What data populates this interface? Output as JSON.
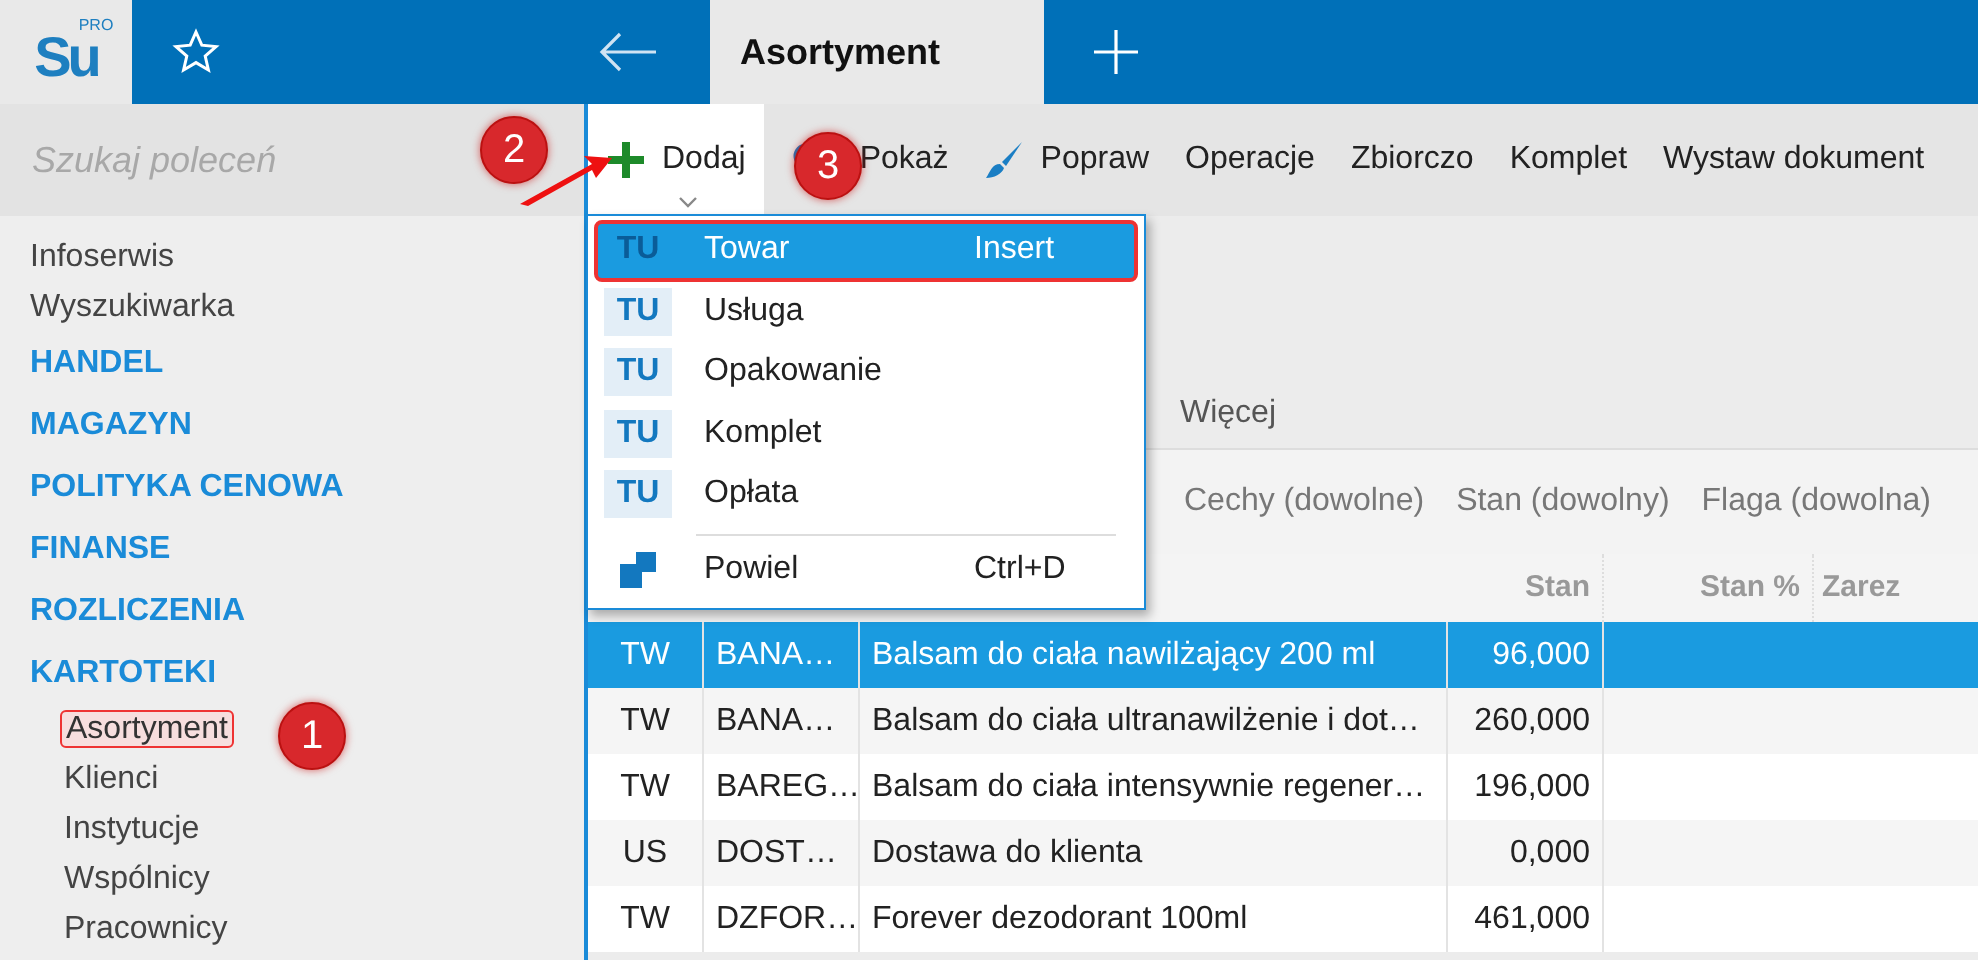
{
  "logo": {
    "text": "Su",
    "sup": "PRO"
  },
  "tabs": [
    {
      "label": "Asortyment",
      "selected": true
    }
  ],
  "search": {
    "placeholder": "Szukaj poleceń"
  },
  "sidebar": {
    "items": [
      {
        "label": "Infoserwis",
        "kind": "link"
      },
      {
        "label": "Wyszukiwarka",
        "kind": "link"
      },
      {
        "label": "HANDEL",
        "kind": "section"
      },
      {
        "label": "MAGAZYN",
        "kind": "section"
      },
      {
        "label": "POLITYKA CENOWA",
        "kind": "section"
      },
      {
        "label": "FINANSE",
        "kind": "section"
      },
      {
        "label": "ROZLICZENIA",
        "kind": "section"
      },
      {
        "label": "KARTOTEKI",
        "kind": "section",
        "children": [
          {
            "label": "Asortyment",
            "selected": true,
            "annotated": true
          },
          {
            "label": "Klienci",
            "selected": false,
            "annotated": false
          },
          {
            "label": "Instytucje",
            "selected": false,
            "annotated": false
          },
          {
            "label": "Wspólnicy",
            "selected": false,
            "annotated": false
          },
          {
            "label": "Pracownicy",
            "selected": false,
            "annotated": false
          }
        ]
      }
    ]
  },
  "toolbar": [
    {
      "label": "Dodaj",
      "kind": "add",
      "selected": true
    },
    {
      "label": "Pokaż",
      "kind": "show",
      "selected": false
    },
    {
      "label": "Popraw",
      "kind": "edit",
      "selected": false
    },
    {
      "label": "Operacje",
      "kind": "plain",
      "selected": false
    },
    {
      "label": "Zbiorczo",
      "kind": "plain",
      "selected": false
    },
    {
      "label": "Komplet",
      "kind": "plain",
      "selected": false
    },
    {
      "label": "Wystaw dokument",
      "kind": "plain",
      "selected": false
    }
  ],
  "menu": [
    {
      "kind": "type",
      "badge": "TU",
      "label": "Towar",
      "shortcut": "Insert",
      "selected": true,
      "annotated": true
    },
    {
      "kind": "type",
      "badge": "TU",
      "label": "Usługa",
      "selected": false,
      "annotated": false
    },
    {
      "kind": "type",
      "badge": "TU",
      "label": "Opakowanie",
      "selected": false,
      "annotated": false
    },
    {
      "kind": "type",
      "badge": "TU",
      "label": "Komplet",
      "selected": false,
      "annotated": false
    },
    {
      "kind": "type",
      "badge": "TU",
      "label": "Opłata",
      "selected": false,
      "annotated": false
    },
    {
      "kind": "copy",
      "label": "Powiel",
      "shortcut": "Ctrl+D",
      "selected": false,
      "annotated": false
    }
  ],
  "view_tabs": [
    {
      "label": "Więcej"
    }
  ],
  "filters": [
    "Cechy (dowolne)",
    "Stan (dowolny)",
    "Flaga (dowolna)"
  ],
  "table": {
    "columns": [
      "Stan",
      "Stan %",
      "Zarez"
    ],
    "rows": [
      {
        "type": "TW",
        "code": "BANA…",
        "name": "Balsam do ciała nawilżający 200 ml",
        "stan": "96,000",
        "selected": true
      },
      {
        "type": "TW",
        "code": "BANA…",
        "name": "Balsam do ciała ultranawilżenie i dot…",
        "stan": "260,000",
        "selected": false
      },
      {
        "type": "TW",
        "code": "BAREG…",
        "name": "Balsam do ciała intensywnie regener…",
        "stan": "196,000",
        "selected": false
      },
      {
        "type": "US",
        "code": "DOST…",
        "name": "Dostawa do klienta",
        "stan": "0,000",
        "selected": false
      },
      {
        "type": "TW",
        "code": "DZFOR…",
        "name": "Forever dezodorant 100ml",
        "stan": "461,000",
        "selected": false
      }
    ]
  },
  "callouts": [
    {
      "label": "1"
    },
    {
      "label": "2"
    },
    {
      "label": "3"
    }
  ]
}
